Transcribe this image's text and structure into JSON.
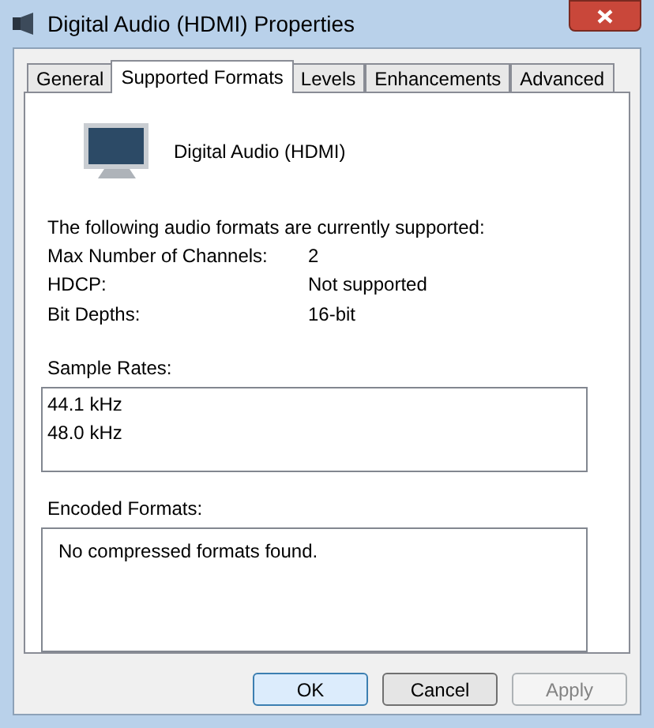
{
  "window": {
    "title": "Digital Audio (HDMI) Properties"
  },
  "tabs": [
    {
      "label": "General",
      "selected": false
    },
    {
      "label": "Supported Formats",
      "selected": true
    },
    {
      "label": "Levels",
      "selected": false
    },
    {
      "label": "Enhancements",
      "selected": false
    },
    {
      "label": "Advanced",
      "selected": false
    }
  ],
  "device": {
    "name": "Digital Audio (HDMI)"
  },
  "intro": "The following audio formats are currently supported:",
  "properties": [
    {
      "label": "Max Number of Channels:",
      "value": "2"
    },
    {
      "label": "HDCP:",
      "value": "Not supported"
    },
    {
      "label": "Bit Depths:",
      "value": "16-bit"
    }
  ],
  "sample_rates": {
    "label": "Sample Rates:",
    "items": [
      "44.1 kHz",
      "48.0 kHz"
    ]
  },
  "encoded_formats": {
    "label": "Encoded Formats:",
    "items": [
      "No compressed formats found."
    ]
  },
  "buttons": [
    {
      "label": "OK",
      "default": true,
      "disabled": false
    },
    {
      "label": "Cancel",
      "default": false,
      "disabled": false
    },
    {
      "label": "Apply",
      "default": false,
      "disabled": true
    }
  ]
}
